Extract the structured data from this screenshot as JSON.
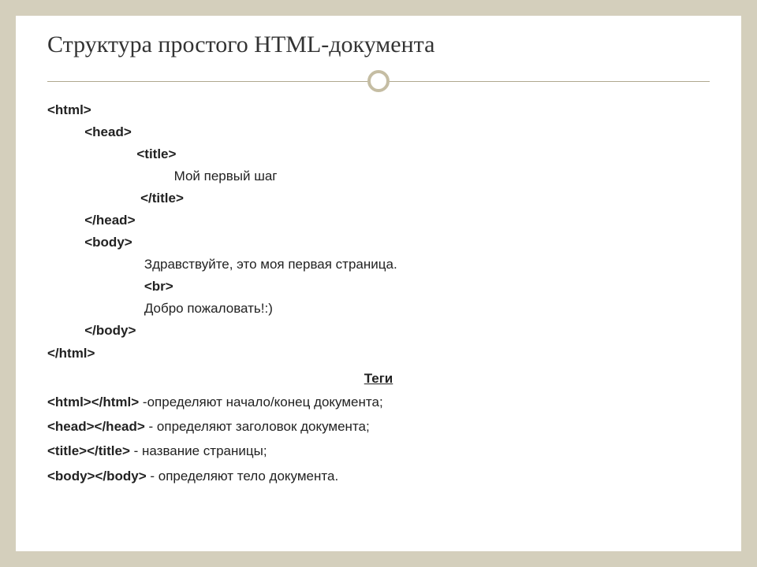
{
  "title": "Структура простого HTML-документа",
  "code": {
    "html_open": "<html>",
    "head_open": "<head>",
    "title_open": "<title>",
    "title_text": "Мой первый шаг",
    "title_close": "</title>",
    "head_close": "</head>",
    "body_open": "<body>",
    "body_text1": "Здравствуйте, это моя первая страница.",
    "br_tag": "<br>",
    "body_text2": "Добро пожаловать!:)",
    "body_close": "</body>",
    "html_close": "</html>"
  },
  "tags_section": {
    "heading": "Теги",
    "html_tags": "<html></html>",
    "html_desc": " -определяют начало/конец документа;",
    "head_tags": "<head></head>",
    "head_desc": " - определяют заголовок документа;",
    "title_tags": "<title></title>",
    "title_desc": " - название страницы;",
    "body_tags": "<body></body>",
    "body_desc": " - определяют тело документа."
  }
}
